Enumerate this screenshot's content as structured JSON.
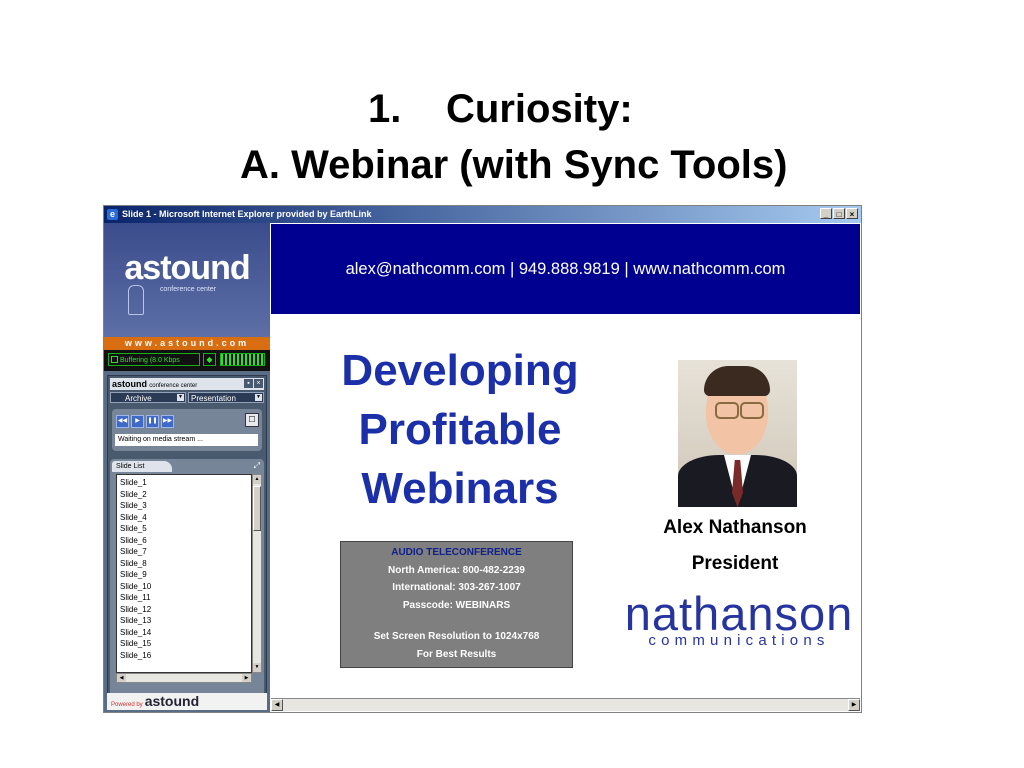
{
  "slide": {
    "title_number": "1.",
    "title_line1": "Curiosity:",
    "title_line2": "A. Webinar (with Sync Tools)"
  },
  "browser": {
    "window_title": "Slide 1 - Microsoft Internet Explorer provided by EarthLink",
    "minimize_glyph": "_",
    "maximize_glyph": "□",
    "close_glyph": "×"
  },
  "sidebar": {
    "logo": "astound",
    "logo_subtitle": "conference center",
    "url": "www.astound.com",
    "buffer_status": "Buffering (8.0 Kbps",
    "panel_brand": "astound",
    "panel_brand_sub": "conference center",
    "panel_pin_glyph": "▪",
    "panel_close_glyph": "×",
    "archive_dropdown": "Archive",
    "presentation_dropdown": "Presentation",
    "controls": {
      "rewind_glyph": "◀◀",
      "play_glyph": "▶",
      "pause_glyph": "❚❚",
      "forward_glyph": "▶▶",
      "chat_glyph": "☐"
    },
    "stream_status": "Waiting on media stream ...",
    "slide_list_tab": "Slide List",
    "slides": [
      "Slide_1",
      "Slide_2",
      "Slide_3",
      "Slide_4",
      "Slide_5",
      "Slide_6",
      "Slide_7",
      "Slide_8",
      "Slide_9",
      "Slide_10",
      "Slide_11",
      "Slide_12",
      "Slide_13",
      "Slide_14",
      "Slide_15",
      "Slide_16"
    ],
    "powered_by": "Powered by",
    "powered_brand": "astound"
  },
  "main": {
    "banner_contact": "alex@nathcomm.com | 949.888.9819 | www.nathcomm.com",
    "headline": [
      "Developing",
      "Profitable",
      "Webinars"
    ],
    "audio": {
      "heading": "AUDIO TELECONFERENCE",
      "north_america": "North America:  800-482-2239",
      "international": "International:  303-267-1007",
      "passcode": "Passcode:  WEBINARS",
      "resolution": "Set Screen Resolution to 1024x768",
      "best_results": "For Best Results"
    },
    "presenter_name": "Alex Nathanson",
    "presenter_title": "President",
    "company_name": "nathanson",
    "company_sub": "communications"
  },
  "colors": {
    "banner": "#000090",
    "headline": "#1a2fa8",
    "url_strip": "#d96d12",
    "audio_box": "#7f7f7f",
    "company_logo": "#2634a0"
  }
}
